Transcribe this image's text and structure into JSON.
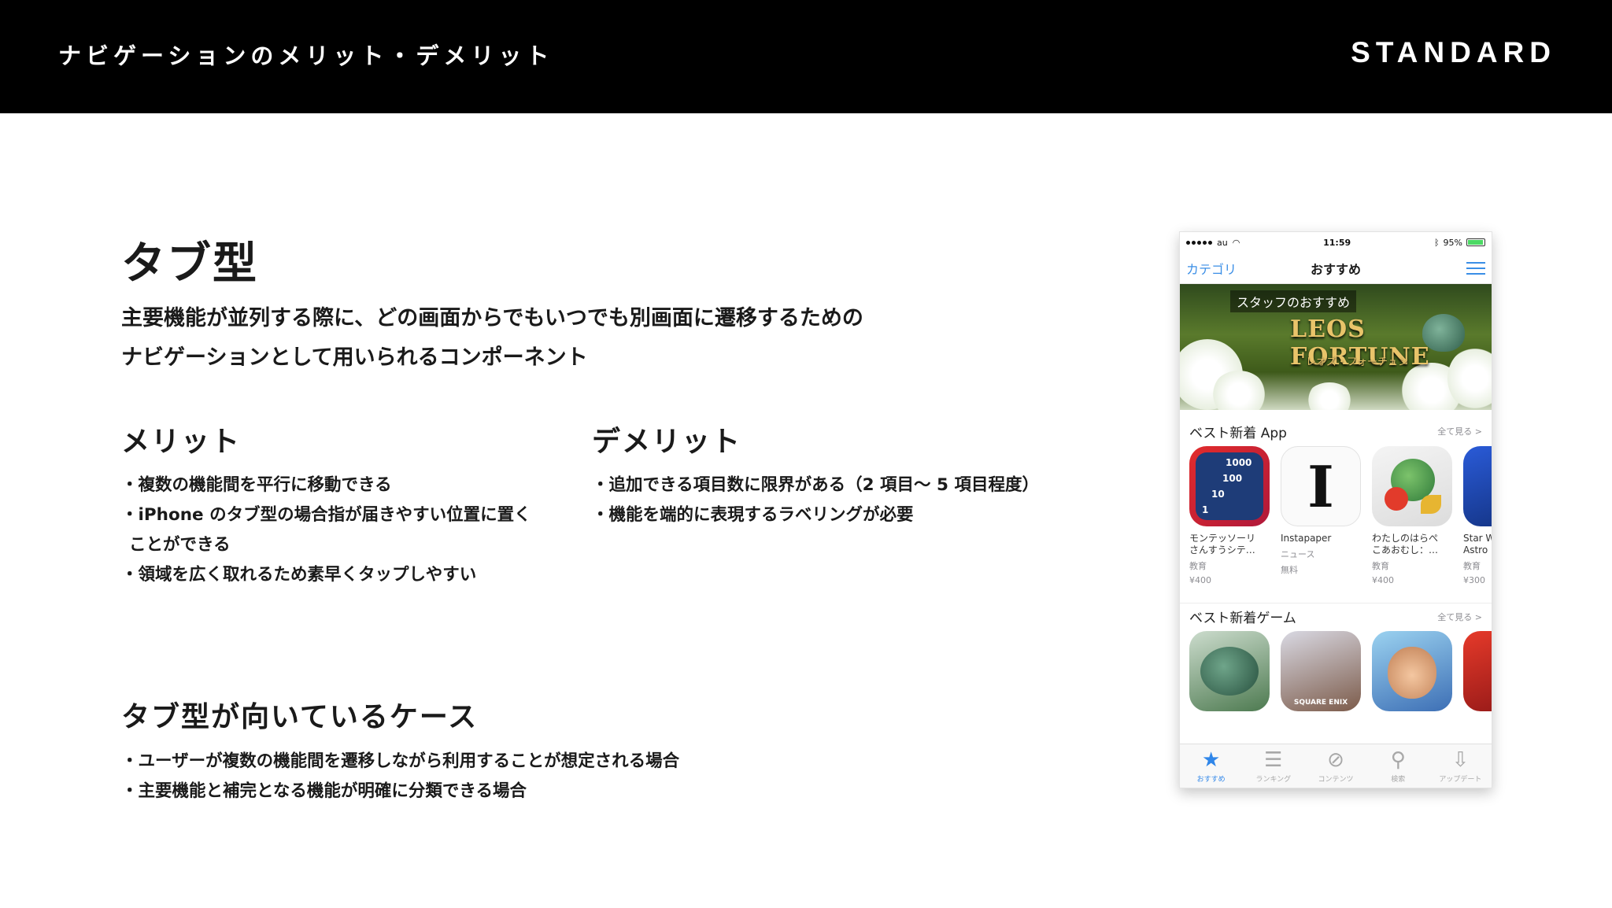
{
  "header": {
    "title": "ナビゲーションのメリット・デメリット",
    "brand": "STANDARD"
  },
  "slide": {
    "title": "タブ型",
    "lead_line1": "主要機能が並列する際に、どの画面からでもいつでも別画面に遷移するための",
    "lead_line2": "ナビゲーションとして用いられるコンポーネント"
  },
  "merit": {
    "heading": "メリット",
    "items": [
      "複数の機能間を平行に移動できる",
      "iPhone のタブ型の場合指が届きやすい位置に置くことができる",
      "領域を広く取れるため素早くタップしやすい"
    ]
  },
  "demerit": {
    "heading": "デメリット",
    "items": [
      "追加できる項目数に限界がある（2 項目〜 5 項目程度）",
      "機能を端的に表現するラベリングが必要"
    ]
  },
  "suited": {
    "heading": "タブ型が向いているケース",
    "items": [
      "ユーザーが複数の機能間を遷移しながら利用することが想定される場合",
      "主要機能と補完となる機能が明確に分類できる場合"
    ]
  },
  "phone": {
    "status": {
      "carrier": "au",
      "time": "11:59",
      "battery": "95%",
      "battery_level": 0.95
    },
    "nav": {
      "left": "カテゴリ",
      "title": "おすすめ",
      "right_icon": "list-icon"
    },
    "banner": {
      "label": "スタッフのおすすめ",
      "logo": "LEOS FORTUNE",
      "subtitle": "レオズ・フォーチュン"
    },
    "section1": {
      "title": "ベスト新着 App",
      "more": "全て見る >",
      "apps": [
        {
          "name": "モンテッソーリ\nさんすうシテ…",
          "category": "教育",
          "price": "¥400",
          "icon_numbers": [
            "1000",
            "100",
            "10",
            "1"
          ]
        },
        {
          "name": "Instapaper",
          "category": "ニュース",
          "price": "無料",
          "icon_glyph": "I"
        },
        {
          "name": "わたしのはらぺ\nこあおむし：…",
          "category": "教育",
          "price": "¥400"
        },
        {
          "name": "Star W\nAstro",
          "category": "教育",
          "price": "¥300"
        }
      ]
    },
    "section2": {
      "title": "ベスト新着ゲーム",
      "more": "全て見る >",
      "icon_tag": "SQUARE ENIX"
    },
    "tabs": [
      {
        "label": "おすすめ",
        "icon": "star-icon",
        "glyph": "★",
        "active": true
      },
      {
        "label": "ランキング",
        "icon": "ranking-list-icon",
        "glyph": "☰",
        "active": false
      },
      {
        "label": "コンテンツ",
        "icon": "compass-icon",
        "glyph": "⊘",
        "active": false
      },
      {
        "label": "検索",
        "icon": "search-icon",
        "glyph": "⚲",
        "active": false
      },
      {
        "label": "アップデート",
        "icon": "download-icon",
        "glyph": "⇩",
        "active": false
      }
    ]
  }
}
